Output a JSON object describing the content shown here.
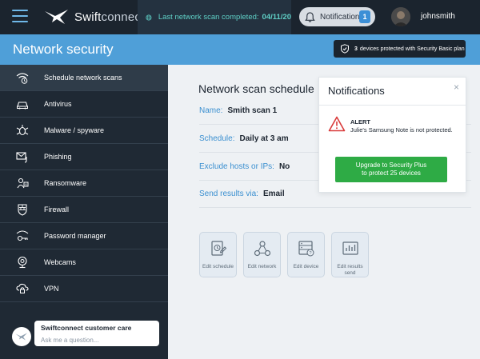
{
  "app": {
    "brand_a": "Swift",
    "brand_b": "connect"
  },
  "topbar": {
    "scan_label": "Last network scan completed:",
    "scan_date": "04/11/20",
    "notifications_label": "Notifications",
    "notifications_count": "1",
    "username": "johnsmith"
  },
  "header": {
    "title": "Network security",
    "badge_count": "3",
    "badge_text": "devices protected with Security Basic plan"
  },
  "sidebar": {
    "items": [
      {
        "label": "Schedule network scans",
        "icon": "wifi-clock-icon",
        "active": true
      },
      {
        "label": "Antivirus",
        "icon": "car-shield-icon"
      },
      {
        "label": "Malware / spyware",
        "icon": "bug-icon"
      },
      {
        "label": "Phishing",
        "icon": "mail-hook-icon"
      },
      {
        "label": "Ransomware",
        "icon": "ransomware-icon"
      },
      {
        "label": "Firewall",
        "icon": "firewall-icon"
      },
      {
        "label": "Password manager",
        "icon": "key-wifi-icon"
      },
      {
        "label": "Webcams",
        "icon": "webcam-icon"
      },
      {
        "label": "VPN",
        "icon": "vpn-icon"
      }
    ]
  },
  "care": {
    "title": "Swiftconnect customer care",
    "placeholder": "Ask me a question..."
  },
  "main": {
    "title": "Network scan schedule",
    "fields": [
      {
        "label": "Name:",
        "value": "Smith scan 1"
      },
      {
        "label": "Schedule:",
        "value": "Daily at 3 am"
      },
      {
        "label": "Exclude hosts or IPs:",
        "value": "No"
      },
      {
        "label": "Send results via:",
        "value": "Email"
      }
    ],
    "actions": [
      {
        "label": "Edit schedule",
        "icon": "edit-schedule-icon"
      },
      {
        "label": "Edit network",
        "icon": "network-icon"
      },
      {
        "label": "Edit device",
        "icon": "device-icon"
      },
      {
        "label_line1": "Edit results",
        "label_line2": "send",
        "icon": "chart-icon"
      }
    ]
  },
  "popup": {
    "title": "Notifications",
    "close": "×",
    "alert_head": "ALERT",
    "alert_text": "Julie's Samsung Note is not protected.",
    "button_line1": "Upgrade to Security Plus",
    "button_line2": "to protect 25 devices"
  },
  "colors": {
    "topbar": "#1b242e",
    "header": "#4f9fd8",
    "sidebar": "#1f2934",
    "accent_teal": "#5fd0c6",
    "accent_blue": "#3a8fd0",
    "upgrade_green": "#2eab45",
    "alert_red": "#d93a3a"
  }
}
